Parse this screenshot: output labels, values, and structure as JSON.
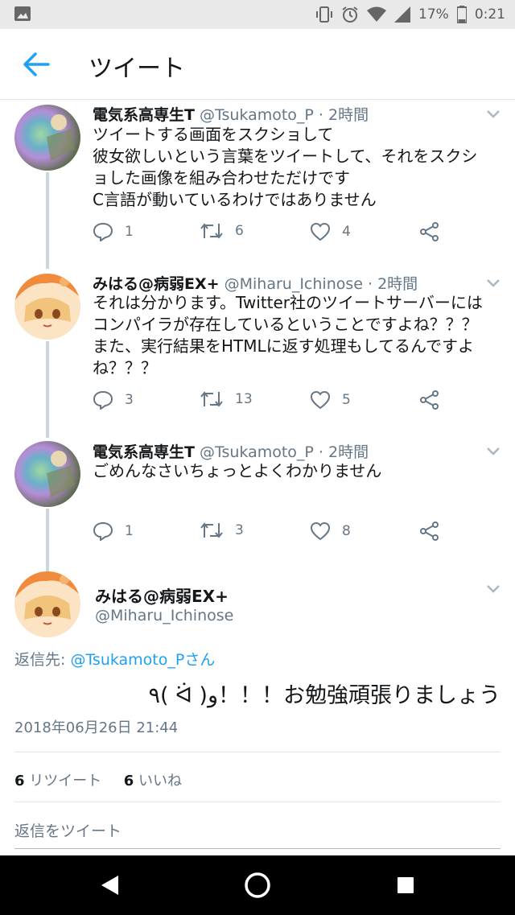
{
  "statusbar": {
    "battery": "17%",
    "time": "0:21"
  },
  "appbar": {
    "title": "ツイート"
  },
  "tweets": [
    {
      "name": "電気系高専生T",
      "meta": "@Tsukamoto_P · 2時間",
      "lines": [
        "ツイートする画面をスクショして",
        "彼女欲しいという言葉をツイートして、それをスクシ",
        "ョした画像を組み合わせただけです",
        "C言語が動いているわけではありません"
      ],
      "replies": "1",
      "retweets": "6",
      "likes": "4"
    },
    {
      "name": "みはる@病弱EX+",
      "meta": "@Miharu_Ichinose · 2時間",
      "lines": [
        "それは分かります。Twitter社のツイートサーバーには",
        "コンパイラが存在しているということですよね？？？",
        "また、実行結果をHTMLに返す処理もしてるんですよ",
        "ね？？？"
      ],
      "replies": "3",
      "retweets": "13",
      "likes": "5"
    },
    {
      "name": "電気系高専生T",
      "meta": "@Tsukamoto_P · 2時間",
      "lines": [
        "ごめんなさいちょっとよくわかりません"
      ],
      "replies": "1",
      "retweets": "3",
      "likes": "8"
    }
  ],
  "main_tweet": {
    "name": "みはる@病弱EX+",
    "handle": "@Miharu_Ichinose",
    "reply_prefix": "返信先: ",
    "reply_mention": "@Tsukamoto_Pさん",
    "text": "٩( ᐛ )و！！！お勉強頑張りましょう",
    "timestamp": "2018年06月26日 21:44",
    "retweet_count": "6",
    "retweet_label": "リツイート",
    "like_count": "6",
    "like_label": "いいね"
  },
  "reply_box": {
    "placeholder": "返信をツイート"
  },
  "colors": {
    "accent": "#1da1f2",
    "secondary_text": "#657786",
    "thread_line": "#ccd6dd"
  }
}
